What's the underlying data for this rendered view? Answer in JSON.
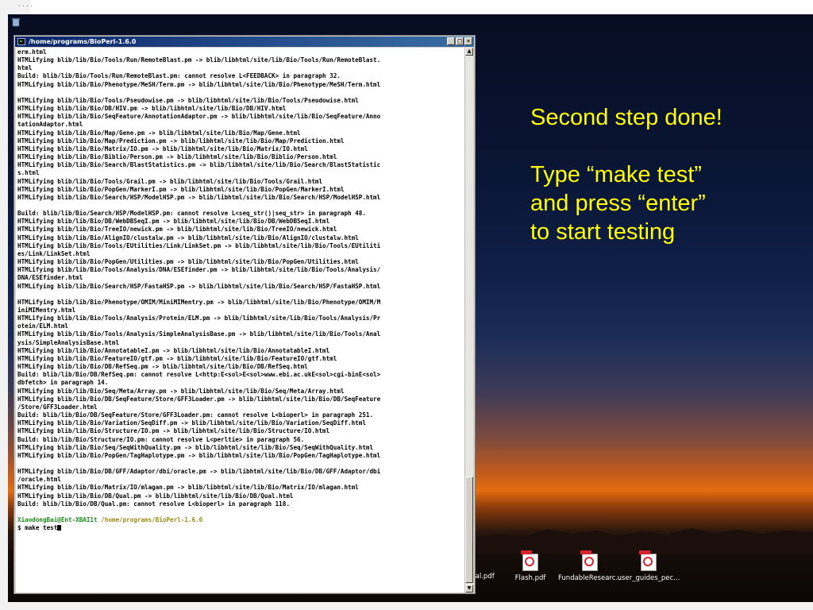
{
  "terminal": {
    "title": "/home/programs/BioPerl-1.6.0",
    "buttons": {
      "minimize": "_",
      "maximize": "□",
      "close": "×"
    },
    "lines": [
      "erm.html",
      "HTMLifying blib/lib/Bio/Tools/Run/RemoteBlast.pm -> blib/libhtml/site/lib/Bio/Tools/Run/RemoteBlast.",
      "html",
      "Build: blib/lib/Bio/Tools/Run/RemoteBlast.pm: cannot resolve L<FEEDBACK> in paragraph 32.",
      "HTMLifying blib/lib/Bio/Phenotype/MeSH/Term.pm -> blib/libhtml/site/lib/Bio/Phenotype/MeSH/Term.html",
      "",
      "HTMLifying blib/lib/Bio/Tools/Pseudowise.pm -> blib/libhtml/site/lib/Bio/Tools/Pseudowise.html",
      "HTMLifying blib/lib/Bio/DB/HIV.pm -> blib/libhtml/site/lib/Bio/DB/HIV.html",
      "HTMLifying blib/lib/Bio/SeqFeature/AnnotationAdaptor.pm -> blib/libhtml/site/lib/Bio/SeqFeature/Anno",
      "tationAdaptor.html",
      "HTMLifying blib/lib/Bio/Map/Gene.pm -> blib/libhtml/site/lib/Bio/Map/Gene.html",
      "HTMLifying blib/lib/Bio/Map/Prediction.pm -> blib/libhtml/site/lib/Bio/Map/Prediction.html",
      "HTMLifying blib/lib/Bio/Matrix/IO.pm -> blib/libhtml/site/lib/Bio/Matrix/IO.html",
      "HTMLifying blib/lib/Bio/Biblio/Person.pm -> blib/libhtml/site/lib/Bio/Biblio/Person.html",
      "HTMLifying blib/lib/Bio/Search/BlastStatistics.pm -> blib/libhtml/site/lib/Bio/Search/BlastStatistic",
      "s.html",
      "HTMLifying blib/lib/Bio/Tools/Grail.pm -> blib/libhtml/site/lib/Bio/Tools/Grail.html",
      "HTMLifying blib/lib/Bio/PopGen/MarkerI.pm -> blib/libhtml/site/lib/Bio/PopGen/MarkerI.html",
      "HTMLifying blib/lib/Bio/Search/HSP/ModelHSP.pm -> blib/libhtml/site/lib/Bio/Search/HSP/ModelHSP.html",
      "",
      "Build: blib/lib/Bio/Search/HSP/ModelHSP.pm: cannot resolve L<seq_str()|seq_str> in paragraph 48.",
      "HTMLifying blib/lib/Bio/DB/WebDBSeqI.pm -> blib/libhtml/site/lib/Bio/DB/WebDBSeqI.html",
      "HTMLifying blib/lib/Bio/TreeIO/newick.pm -> blib/libhtml/site/lib/Bio/TreeIO/newick.html",
      "HTMLifying blib/lib/Bio/AlignIO/clustalw.pm -> blib/libhtml/site/lib/Bio/AlignIO/clustalw.html",
      "HTMLifying blib/lib/Bio/Tools/EUtilities/Link/LinkSet.pm -> blib/libhtml/site/lib/Bio/Tools/EUtiliti",
      "es/Link/LinkSet.html",
      "HTMLifying blib/lib/Bio/PopGen/Utilities.pm -> blib/libhtml/site/lib/Bio/PopGen/Utilities.html",
      "HTMLifying blib/lib/Bio/Tools/Analysis/DNA/ESEfinder.pm -> blib/libhtml/site/lib/Bio/Tools/Analysis/",
      "DNA/ESEfinder.html",
      "HTMLifying blib/lib/Bio/Search/HSP/FastaHSP.pm -> blib/libhtml/site/lib/Bio/Search/HSP/FastaHSP.html",
      "",
      "HTMLifying blib/lib/Bio/Phenotype/OMIM/MiniMIMentry.pm -> blib/libhtml/site/lib/Bio/Phenotype/OMIM/M",
      "iniMIMentry.html",
      "HTMLifying blib/lib/Bio/Tools/Analysis/Protein/ELM.pm -> blib/libhtml/site/lib/Bio/Tools/Analysis/Pr",
      "otein/ELM.html",
      "HTMLifying blib/lib/Bio/Tools/Analysis/SimpleAnalysisBase.pm -> blib/libhtml/site/lib/Bio/Tools/Anal",
      "ysis/SimpleAnalysisBase.html",
      "HTMLifying blib/lib/Bio/AnnotatableI.pm -> blib/libhtml/site/lib/Bio/AnnotatableI.html",
      "HTMLifying blib/lib/Bio/FeatureIO/gtf.pm -> blib/libhtml/site/lib/Bio/FeatureIO/gtf.html",
      "HTMLifying blib/lib/Bio/DB/RefSeq.pm -> blib/libhtml/site/lib/Bio/DB/RefSeq.html",
      "Build: blib/lib/Bio/DB/RefSeq.pm: cannot resolve L<http:E<sol>E<sol>www.ebi.ac.ukE<sol>cgi-binE<sol>",
      "dbfetch> in paragraph 14.",
      "HTMLifying blib/lib/Bio/Seq/Meta/Array.pm -> blib/libhtml/site/lib/Bio/Seq/Meta/Array.html",
      "HTMLifying blib/lib/Bio/DB/SeqFeature/Store/GFF3Loader.pm -> blib/libhtml/site/lib/Bio/DB/SeqFeature",
      "/Store/GFF3Loader.html",
      "Build: blib/lib/Bio/DB/SeqFeature/Store/GFF3Loader.pm: cannot resolve L<bioperl> in paragraph 251.",
      "HTMLifying blib/lib/Bio/Variation/SeqDiff.pm -> blib/libhtml/site/lib/Bio/Variation/SeqDiff.html",
      "HTMLifying blib/lib/Bio/Structure/IO.pm -> blib/libhtml/site/lib/Bio/Structure/IO.html",
      "Build: blib/lib/Bio/Structure/IO.pm: cannot resolve L<perltie> in paragraph 56.",
      "HTMLifying blib/lib/Bio/Seq/SeqWithQuality.pm -> blib/libhtml/site/lib/Bio/Seq/SeqWithQuality.html",
      "HTMLifying blib/lib/Bio/PopGen/TagHaplotype.pm -> blib/libhtml/site/lib/Bio/PopGen/TagHaplotype.html",
      "",
      "HTMLifying blib/lib/Bio/DB/GFF/Adaptor/dbi/oracle.pm -> blib/libhtml/site/lib/Bio/DB/GFF/Adaptor/dbi",
      "/oracle.html",
      "HTMLifying blib/lib/Bio/Matrix/IO/mlagan.pm -> blib/libhtml/site/lib/Bio/Matrix/IO/mlagan.html",
      "HTMLifying blib/lib/Bio/DB/Qual.pm -> blib/libhtml/site/lib/Bio/DB/Qual.html",
      "Build: blib/lib/Bio/DB/Qual.pm: cannot resolve L<bioperl> in paragraph 118.",
      ""
    ],
    "prompt": {
      "user": "XiaodongBai@Ent-XBAI1t",
      "path": "/home/programs/BioPerl-1.6.0"
    },
    "command": "$ make test"
  },
  "slide": {
    "line1": "Second step done!",
    "line2": "Type “make test”",
    "line3": "and press “enter”",
    "line4": "to start testing"
  },
  "desktop_icons": [
    {
      "label": "ual.pdf"
    },
    {
      "label": "Flash.pdf"
    },
    {
      "label": "FundableResearc..."
    },
    {
      "label": "user_guides_pec..."
    }
  ],
  "colors": {
    "slide_text": "#ffff00",
    "prompt_user": "#1a8a1a",
    "prompt_path": "#9a8a14",
    "titlebar": "#0a246a"
  }
}
